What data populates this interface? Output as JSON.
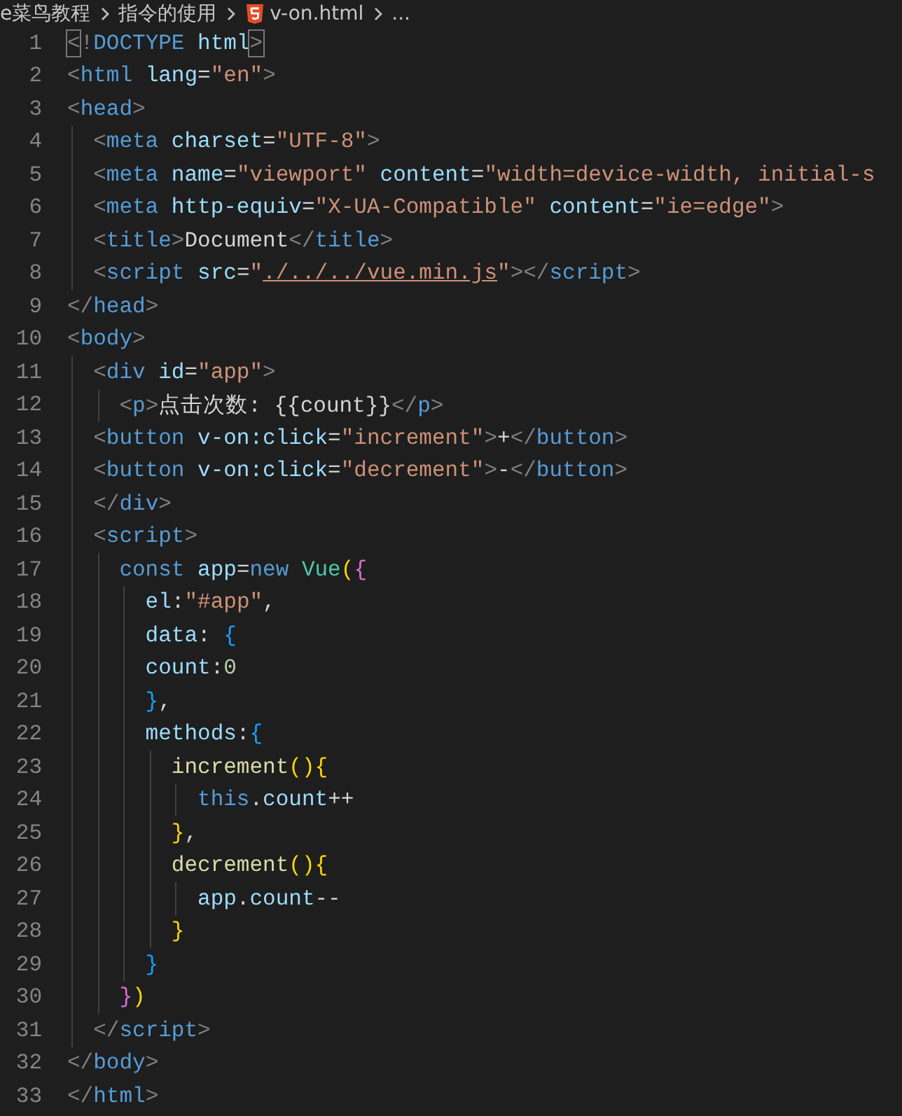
{
  "breadcrumb": [
    {
      "label": "e菜鸟教程",
      "kind": "folder"
    },
    {
      "label": "指令的使用",
      "kind": "folder"
    },
    {
      "label": "v-on.html",
      "kind": "html-file"
    },
    {
      "label": "...",
      "kind": "more"
    }
  ],
  "lines": [
    {
      "number": "1",
      "tokens": [
        {
          "kind": "match",
          "text": "<"
        },
        {
          "kind": "p",
          "text": "!"
        },
        {
          "kind": "tag",
          "text": "DOCTYPE"
        },
        {
          "kind": "attr",
          "text": " html"
        },
        {
          "kind": "match",
          "text": ">"
        }
      ]
    },
    {
      "number": "2",
      "tokens": [
        {
          "kind": "p",
          "text": "<"
        },
        {
          "kind": "tag",
          "text": "html"
        },
        {
          "kind": "attr",
          "text": " lang"
        },
        {
          "kind": "text",
          "text": "="
        },
        {
          "kind": "str",
          "text": "\"en\""
        },
        {
          "kind": "p",
          "text": ">"
        }
      ]
    },
    {
      "number": "3",
      "tokens": [
        {
          "kind": "p",
          "text": "<"
        },
        {
          "kind": "tag",
          "text": "head"
        },
        {
          "kind": "p",
          "text": ">"
        }
      ]
    },
    {
      "number": "4",
      "tokens": [
        {
          "kind": "p",
          "text": "  <"
        },
        {
          "kind": "tag",
          "text": "meta"
        },
        {
          "kind": "attr",
          "text": " charset"
        },
        {
          "kind": "text",
          "text": "="
        },
        {
          "kind": "str",
          "text": "\"UTF-8\""
        },
        {
          "kind": "p",
          "text": ">"
        }
      ]
    },
    {
      "number": "5",
      "tokens": [
        {
          "kind": "p",
          "text": "  <"
        },
        {
          "kind": "tag",
          "text": "meta"
        },
        {
          "kind": "attr",
          "text": " name"
        },
        {
          "kind": "text",
          "text": "="
        },
        {
          "kind": "str",
          "text": "\"viewport\""
        },
        {
          "kind": "attr",
          "text": " content"
        },
        {
          "kind": "text",
          "text": "="
        },
        {
          "kind": "str",
          "text": "\"width=device-width, initial-s"
        }
      ]
    },
    {
      "number": "6",
      "tokens": [
        {
          "kind": "p",
          "text": "  <"
        },
        {
          "kind": "tag",
          "text": "meta"
        },
        {
          "kind": "attr",
          "text": " http-equiv"
        },
        {
          "kind": "text",
          "text": "="
        },
        {
          "kind": "str",
          "text": "\"X-UA-Compatible\""
        },
        {
          "kind": "attr",
          "text": " content"
        },
        {
          "kind": "text",
          "text": "="
        },
        {
          "kind": "str",
          "text": "\"ie=edge\""
        },
        {
          "kind": "p",
          "text": ">"
        }
      ]
    },
    {
      "number": "7",
      "tokens": [
        {
          "kind": "p",
          "text": "  <"
        },
        {
          "kind": "tag",
          "text": "title"
        },
        {
          "kind": "p",
          "text": ">"
        },
        {
          "kind": "text",
          "text": "Document"
        },
        {
          "kind": "p",
          "text": "</"
        },
        {
          "kind": "tag",
          "text": "title"
        },
        {
          "kind": "p",
          "text": ">"
        }
      ]
    },
    {
      "number": "8",
      "tokens": [
        {
          "kind": "p",
          "text": "  <"
        },
        {
          "kind": "tag",
          "text": "script"
        },
        {
          "kind": "attr",
          "text": " src"
        },
        {
          "kind": "text",
          "text": "="
        },
        {
          "kind": "str",
          "text": "\""
        },
        {
          "kind": "link",
          "text": "./../../vue.min.js"
        },
        {
          "kind": "str",
          "text": "\""
        },
        {
          "kind": "p",
          "text": "></"
        },
        {
          "kind": "tag",
          "text": "script"
        },
        {
          "kind": "p",
          "text": ">"
        }
      ]
    },
    {
      "number": "9",
      "tokens": [
        {
          "kind": "p",
          "text": "</"
        },
        {
          "kind": "tag",
          "text": "head"
        },
        {
          "kind": "p",
          "text": ">"
        }
      ]
    },
    {
      "number": "10",
      "tokens": [
        {
          "kind": "p",
          "text": "<"
        },
        {
          "kind": "tag",
          "text": "body"
        },
        {
          "kind": "p",
          "text": ">"
        }
      ]
    },
    {
      "number": "11",
      "tokens": [
        {
          "kind": "p",
          "text": "  <"
        },
        {
          "kind": "tag",
          "text": "div"
        },
        {
          "kind": "attr",
          "text": " id"
        },
        {
          "kind": "text",
          "text": "="
        },
        {
          "kind": "str",
          "text": "\"app\""
        },
        {
          "kind": "p",
          "text": ">"
        }
      ]
    },
    {
      "number": "12",
      "tokens": [
        {
          "kind": "p",
          "text": "    <"
        },
        {
          "kind": "tag",
          "text": "p"
        },
        {
          "kind": "p",
          "text": ">"
        },
        {
          "kind": "text",
          "text": "点击次数: {{count}}"
        },
        {
          "kind": "p",
          "text": "</"
        },
        {
          "kind": "tag",
          "text": "p"
        },
        {
          "kind": "p",
          "text": ">"
        }
      ]
    },
    {
      "number": "13",
      "tokens": [
        {
          "kind": "p",
          "text": "  <"
        },
        {
          "kind": "tag",
          "text": "button"
        },
        {
          "kind": "attr",
          "text": " v-on:click"
        },
        {
          "kind": "text",
          "text": "="
        },
        {
          "kind": "str",
          "text": "\"increment\""
        },
        {
          "kind": "p",
          "text": ">"
        },
        {
          "kind": "text",
          "text": "+"
        },
        {
          "kind": "p",
          "text": "</"
        },
        {
          "kind": "tag",
          "text": "button"
        },
        {
          "kind": "p",
          "text": ">"
        }
      ]
    },
    {
      "number": "14",
      "tokens": [
        {
          "kind": "p",
          "text": "  <"
        },
        {
          "kind": "tag",
          "text": "button"
        },
        {
          "kind": "attr",
          "text": " v-on:click"
        },
        {
          "kind": "text",
          "text": "="
        },
        {
          "kind": "str",
          "text": "\"decrement\""
        },
        {
          "kind": "p",
          "text": ">"
        },
        {
          "kind": "text",
          "text": "-"
        },
        {
          "kind": "p",
          "text": "</"
        },
        {
          "kind": "tag",
          "text": "button"
        },
        {
          "kind": "p",
          "text": ">"
        }
      ]
    },
    {
      "number": "15",
      "tokens": [
        {
          "kind": "p",
          "text": "  </"
        },
        {
          "kind": "tag",
          "text": "div"
        },
        {
          "kind": "p",
          "text": ">"
        }
      ]
    },
    {
      "number": "16",
      "tokens": [
        {
          "kind": "p",
          "text": "  <"
        },
        {
          "kind": "tag",
          "text": "script"
        },
        {
          "kind": "p",
          "text": ">"
        }
      ]
    },
    {
      "number": "17",
      "tokens": [
        {
          "kind": "kw",
          "text": "    const"
        },
        {
          "kind": "var",
          "text": " app"
        },
        {
          "kind": "text",
          "text": "="
        },
        {
          "kind": "kw",
          "text": "new"
        },
        {
          "kind": "cls",
          "text": " Vue"
        },
        {
          "kind": "b1",
          "text": "("
        },
        {
          "kind": "b2",
          "text": "{"
        }
      ]
    },
    {
      "number": "18",
      "tokens": [
        {
          "kind": "var",
          "text": "      el"
        },
        {
          "kind": "text",
          "text": ":"
        },
        {
          "kind": "str",
          "text": "\"#app\""
        },
        {
          "kind": "text",
          "text": ","
        }
      ]
    },
    {
      "number": "19",
      "tokens": [
        {
          "kind": "var",
          "text": "      data"
        },
        {
          "kind": "text",
          "text": ": "
        },
        {
          "kind": "b3",
          "text": "{"
        }
      ]
    },
    {
      "number": "20",
      "tokens": [
        {
          "kind": "var",
          "text": "      count"
        },
        {
          "kind": "text",
          "text": ":"
        },
        {
          "kind": "num",
          "text": "0"
        }
      ]
    },
    {
      "number": "21",
      "tokens": [
        {
          "kind": "b3",
          "text": "      }"
        },
        {
          "kind": "text",
          "text": ","
        }
      ]
    },
    {
      "number": "22",
      "tokens": [
        {
          "kind": "var",
          "text": "      methods"
        },
        {
          "kind": "text",
          "text": ":"
        },
        {
          "kind": "b3",
          "text": "{"
        }
      ]
    },
    {
      "number": "23",
      "tokens": [
        {
          "kind": "fn",
          "text": "        increment"
        },
        {
          "kind": "b1",
          "text": "(){"
        }
      ]
    },
    {
      "number": "24",
      "tokens": [
        {
          "kind": "kw",
          "text": "          this"
        },
        {
          "kind": "text",
          "text": "."
        },
        {
          "kind": "var",
          "text": "count"
        },
        {
          "kind": "text",
          "text": "++"
        }
      ]
    },
    {
      "number": "25",
      "tokens": [
        {
          "kind": "b1",
          "text": "        }"
        },
        {
          "kind": "text",
          "text": ","
        }
      ]
    },
    {
      "number": "26",
      "tokens": [
        {
          "kind": "fn",
          "text": "        decrement"
        },
        {
          "kind": "b1",
          "text": "(){"
        }
      ]
    },
    {
      "number": "27",
      "tokens": [
        {
          "kind": "var",
          "text": "          app"
        },
        {
          "kind": "text",
          "text": "."
        },
        {
          "kind": "var",
          "text": "count"
        },
        {
          "kind": "text",
          "text": "--"
        }
      ]
    },
    {
      "number": "28",
      "tokens": [
        {
          "kind": "b1",
          "text": "        }"
        }
      ]
    },
    {
      "number": "29",
      "tokens": [
        {
          "kind": "b3",
          "text": "      }"
        }
      ]
    },
    {
      "number": "30",
      "tokens": [
        {
          "kind": "b2",
          "text": "    }"
        },
        {
          "kind": "b1",
          "text": ")"
        }
      ]
    },
    {
      "number": "31",
      "tokens": [
        {
          "kind": "p",
          "text": "  </"
        },
        {
          "kind": "tag",
          "text": "script"
        },
        {
          "kind": "p",
          "text": ">"
        }
      ]
    },
    {
      "number": "32",
      "tokens": [
        {
          "kind": "p",
          "text": "</"
        },
        {
          "kind": "tag",
          "text": "body"
        },
        {
          "kind": "p",
          "text": ">"
        }
      ]
    },
    {
      "number": "33",
      "tokens": [
        {
          "kind": "p",
          "text": "</"
        },
        {
          "kind": "tag",
          "text": "html"
        },
        {
          "kind": "p",
          "text": ">"
        }
      ]
    }
  ]
}
